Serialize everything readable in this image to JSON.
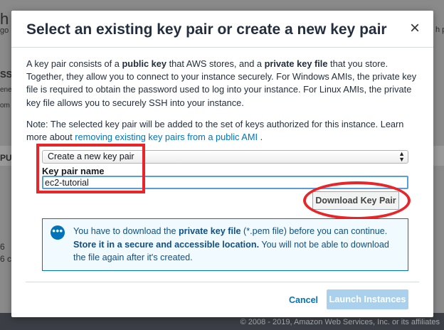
{
  "background": {
    "fragments": [
      "h",
      "go b",
      "SS",
      "ener",
      "om",
      "PUs",
      "6",
      "6 c",
      "h pi"
    ],
    "footer": "© 2008 - 2019, Amazon Web Services, Inc. or its affiliates"
  },
  "modal": {
    "title": "Select an existing key pair or create a new key pair",
    "close_glyph": "×",
    "description": {
      "t1": "A key pair consists of a ",
      "b1": "public key",
      "t2": " that AWS stores, and a ",
      "b2": "private key file",
      "t3": " that you store. Together, they allow you to connect to your instance securely. For Windows AMIs, the private key file is required to obtain the password used to log into your instance. For Linux AMIs, the private key file allows you to securely SSH into your instance."
    },
    "note": {
      "text": "Note: The selected key pair will be added to the set of keys authorized for this instance. Learn more about ",
      "link": "removing existing key pairs from a public AMI",
      "end": " ."
    },
    "key_pair_select": {
      "selected": "Create a new key pair"
    },
    "key_pair_name": {
      "label": "Key pair name",
      "value": "ec2-tutorial"
    },
    "download_button": "Download Key Pair",
    "info": {
      "icon_glyph": "•••",
      "t1": "You have to download the ",
      "b1": "private key file",
      "t2": " (*.pem file) before you can continue. ",
      "b2": "Store it in a secure and accessible location.",
      "t3": " You will not be able to download the file again after it's created."
    },
    "cancel_label": "Cancel",
    "launch_label": "Launch Instances"
  },
  "colors": {
    "accent": "#0073bb",
    "annotation_red": "#e8262a",
    "info_background": "#f1faff",
    "launch_disabled": "#a9d0ec"
  }
}
